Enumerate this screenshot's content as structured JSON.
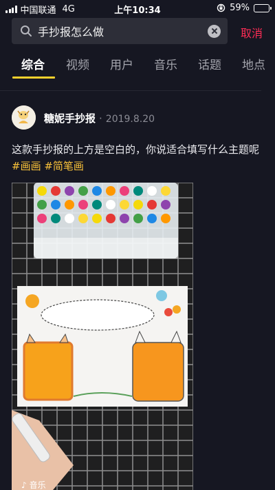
{
  "status_bar": {
    "carrier": "中国联通",
    "network": "4G",
    "time": "上午10:34",
    "battery": "59%",
    "battery_level": 0.59
  },
  "search": {
    "query": "手抄报怎么做",
    "cancel_label": "取消"
  },
  "tabs": [
    {
      "label": "综合",
      "active": true
    },
    {
      "label": "视频",
      "active": false
    },
    {
      "label": "用户",
      "active": false
    },
    {
      "label": "音乐",
      "active": false
    },
    {
      "label": "话题",
      "active": false
    },
    {
      "label": "地点",
      "active": false
    }
  ],
  "post": {
    "author": "糖妮手抄报",
    "separator": "·",
    "date": "2019.8.20",
    "text": "这款手抄报的上方是空白的，你说适合填写什么主题呢",
    "hashtags": [
      "#画画",
      "#简笔画"
    ]
  },
  "video": {
    "music_label": "音乐"
  },
  "colors": {
    "background": "#161722",
    "accent": "#fbd12d",
    "cancel": "#fe2c55",
    "hashtag": "#fbc33a"
  }
}
